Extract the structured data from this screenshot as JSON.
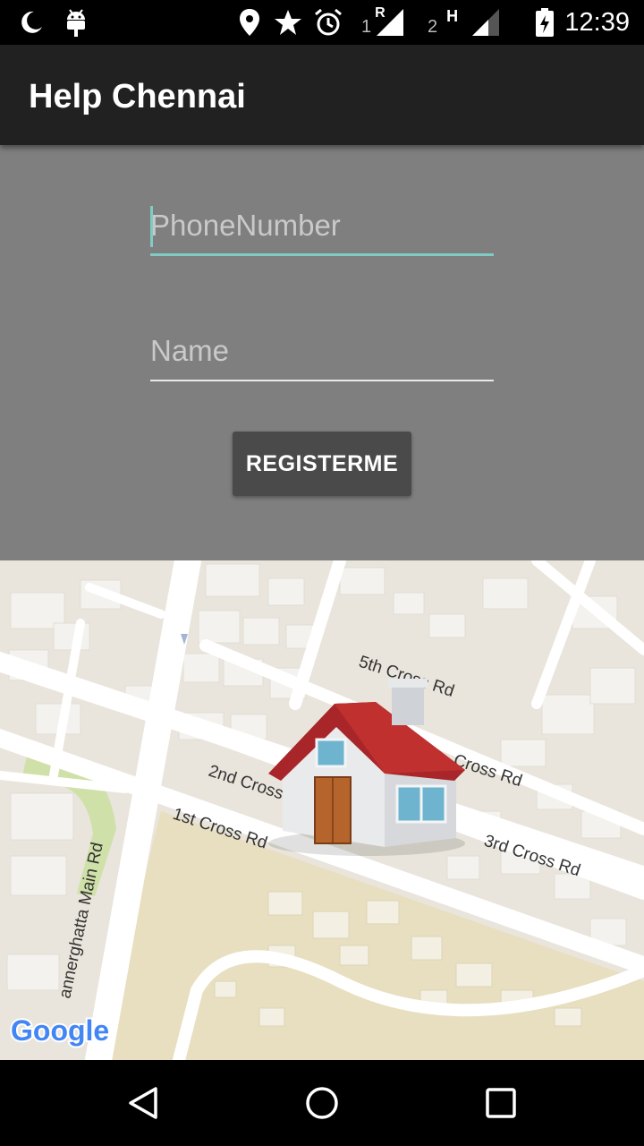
{
  "status_bar": {
    "time": "12:39",
    "sim1_label": "1",
    "sim1_roaming": "R",
    "sim2_label": "2",
    "network_type": "H",
    "icons": [
      "moon-icon",
      "android-debug-icon",
      "location-icon",
      "star-icon",
      "alarm-icon",
      "signal-icon",
      "battery-charging-icon"
    ]
  },
  "app_bar": {
    "title": "Help Chennai"
  },
  "form": {
    "phone_placeholder": "PhoneNumber",
    "name_placeholder": "Name",
    "register_label": "REGISTERME",
    "accent_color": "#80cbc4"
  },
  "map": {
    "road_labels": [
      "5th Cross Rd",
      "Cross Rd",
      "2nd Cross",
      "1st Cross Rd",
      "3rd Cross Rd",
      "annerghatta Main Rd"
    ],
    "logo_text": "Google",
    "marker": "house-icon"
  },
  "nav_bar": {
    "icons": [
      "back-icon",
      "home-icon",
      "recents-icon"
    ]
  }
}
